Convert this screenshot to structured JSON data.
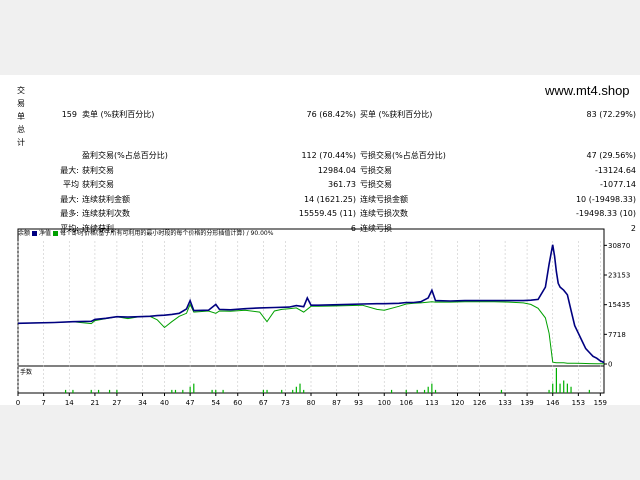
{
  "page": {
    "side_label": [
      "交",
      "易",
      "单",
      "总",
      "计"
    ],
    "watermark": "www.mt4.shop"
  },
  "stats": {
    "rows": [
      {
        "c0": "",
        "c1": "159",
        "c2": "卖单 (%获利百分比)",
        "c3": "76 (68.42%)",
        "c4": "买单 (%获利百分比)",
        "c5": "83 (72.29%)"
      },
      {
        "c0": "",
        "c1": "",
        "c2": "盈利交易(%占总百分比)",
        "c3": "112 (70.44%)",
        "c4": "亏损交易(%占总百分比)",
        "c5": "47 (29.56%)"
      },
      {
        "c0": "最大:",
        "c1": "",
        "c2": "获利交易",
        "c3": "12984.04",
        "c4": "亏损交易",
        "c5": "-13124.64"
      },
      {
        "c0": "平均",
        "c1": "",
        "c2": "获利交易",
        "c3": "361.73",
        "c4": "亏损交易",
        "c5": "-1077.14"
      },
      {
        "c0": "最大:",
        "c1": "",
        "c2": "连续获利金额",
        "c3": "14 (1621.25)",
        "c4": "连续亏损金额",
        "c5": "10 (-19498.33)"
      },
      {
        "c0": "最多:",
        "c1": "",
        "c2": "连续获利次数",
        "c3": "15559.45 (11)",
        "c4": "连续亏损次数",
        "c5": "-19498.33 (10)"
      },
      {
        "c0": "平均:",
        "c1": "",
        "c2": "连续获利",
        "c3": "6",
        "c4": "连续亏损",
        "c5": "2"
      }
    ]
  },
  "chart_legend": {
    "balance_label": "余额",
    "equity_label": "净值",
    "note": "每个即时价格(基于所有可利用的最小时段的每个价格的分形插值计算) / 90.00%",
    "balance_color": "#000080",
    "equity_color": "#00a000"
  },
  "chart_data": {
    "type": "line",
    "x_ticks": [
      "0",
      "7",
      "14",
      "21",
      "27",
      "34",
      "40",
      "47",
      "54",
      "60",
      "67",
      "73",
      "80",
      "87",
      "93",
      "100",
      "106",
      "113",
      "120",
      "126",
      "133",
      "139",
      "146",
      "153",
      "159"
    ],
    "y_ticks": [
      "30870",
      "23153",
      "15435",
      "7718",
      "0"
    ],
    "xlim": [
      0,
      160
    ],
    "ylim": [
      0,
      32000
    ],
    "volume_label": "手数",
    "series": [
      {
        "name": "余额",
        "color": "#000080",
        "x": [
          0,
          10,
          15,
          20,
          21,
          24,
          27,
          30,
          33,
          36,
          38,
          40,
          42,
          44,
          46,
          47,
          48,
          52,
          54,
          55,
          58,
          62,
          66,
          70,
          74,
          76,
          78,
          79,
          80,
          82,
          86,
          90,
          94,
          98,
          100,
          104,
          106,
          108,
          110,
          112,
          113,
          114,
          118,
          122,
          126,
          130,
          134,
          138,
          140,
          142,
          144,
          145,
          146,
          146.5,
          147,
          147.5,
          148,
          149,
          150,
          151,
          152,
          153,
          154,
          155,
          156,
          157,
          158,
          159,
          160
        ],
        "y": [
          10600,
          10800,
          11000,
          11100,
          11600,
          11900,
          12300,
          12200,
          12300,
          12400,
          12600,
          12700,
          12900,
          13200,
          14300,
          16500,
          13900,
          14000,
          15500,
          14200,
          14100,
          14400,
          14600,
          14700,
          14800,
          15200,
          14900,
          17200,
          15300,
          15300,
          15400,
          15500,
          15600,
          15700,
          15700,
          15800,
          16000,
          16000,
          16200,
          17200,
          19200,
          16500,
          16400,
          16500,
          16500,
          16500,
          16500,
          16500,
          16600,
          16800,
          20000,
          26000,
          31000,
          28000,
          24000,
          21000,
          20000,
          19200,
          18000,
          14000,
          10000,
          8000,
          6000,
          4000,
          3000,
          2000,
          1500,
          800,
          400
        ]
      },
      {
        "name": "净值",
        "color": "#00a000",
        "x": [
          0,
          10,
          15,
          20,
          21,
          24,
          27,
          30,
          33,
          36,
          38,
          40,
          42,
          44,
          46,
          47,
          48,
          52,
          54,
          55,
          58,
          62,
          66,
          68,
          70,
          72,
          74,
          76,
          78,
          80,
          82,
          86,
          90,
          94,
          98,
          100,
          104,
          106,
          108,
          110,
          113,
          114,
          118,
          122,
          126,
          130,
          134,
          138,
          140,
          142,
          144,
          145,
          146,
          146.5,
          147,
          149,
          150,
          152,
          154,
          156,
          158,
          159,
          160
        ],
        "y": [
          10600,
          10800,
          11000,
          10500,
          11300,
          11800,
          12300,
          11800,
          12300,
          12400,
          11500,
          9500,
          11000,
          12400,
          13200,
          15500,
          13500,
          13800,
          13200,
          13800,
          13700,
          14000,
          13500,
          11000,
          13800,
          14200,
          14400,
          14600,
          13500,
          15000,
          15000,
          15100,
          15200,
          15300,
          14200,
          14000,
          15000,
          15600,
          15800,
          15900,
          16200,
          16100,
          16100,
          16200,
          16200,
          16200,
          16100,
          15900,
          15500,
          14500,
          12000,
          8000,
          500,
          400,
          300,
          300,
          200,
          200,
          150,
          100,
          80,
          60,
          50
        ]
      }
    ],
    "volume": [
      0,
      0,
      0,
      0,
      0,
      0,
      0,
      0,
      0,
      0,
      0,
      0,
      0,
      1,
      0,
      1,
      0,
      0,
      0,
      0,
      1,
      0,
      1,
      0,
      0,
      1,
      0,
      1,
      0,
      0,
      0,
      0,
      0,
      0,
      0,
      0,
      0,
      0,
      0,
      0,
      0,
      0,
      1,
      1,
      0,
      1,
      0,
      2,
      3,
      0,
      0,
      0,
      0,
      1,
      1,
      0,
      1,
      0,
      0,
      0,
      0,
      0,
      0,
      0,
      0,
      0,
      0,
      1,
      1,
      0,
      0,
      0,
      1,
      0,
      0,
      1,
      2,
      3,
      1,
      0,
      0,
      0,
      0,
      0,
      0,
      0,
      0,
      0,
      0,
      0,
      0,
      0,
      0,
      0,
      0,
      0,
      0,
      0,
      0,
      0,
      0,
      0,
      1,
      0,
      0,
      0,
      1,
      0,
      0,
      1,
      0,
      1,
      2,
      3,
      1,
      0,
      0,
      0,
      0,
      0,
      0,
      0,
      0,
      0,
      0,
      0,
      0,
      0,
      0,
      0,
      0,
      0,
      1,
      0,
      0,
      0,
      0,
      0,
      0,
      0,
      0,
      0,
      0,
      0,
      0,
      1,
      3,
      8,
      3,
      4,
      3,
      2,
      0,
      0,
      0,
      0,
      1,
      0,
      0,
      0,
      0
    ]
  }
}
